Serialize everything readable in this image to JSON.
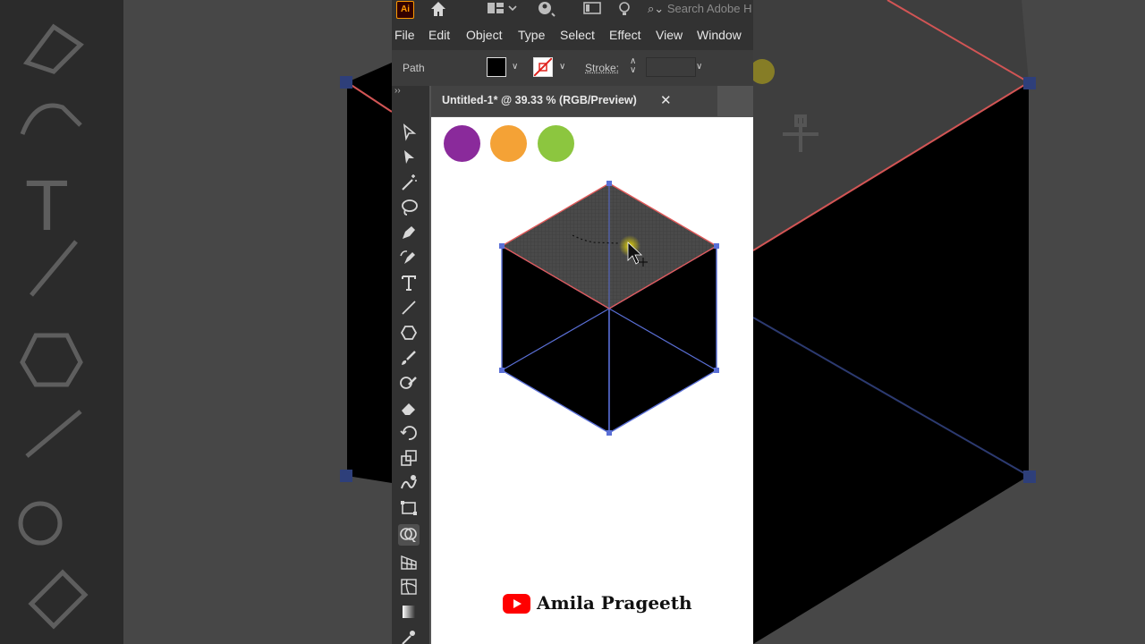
{
  "app": {
    "logo_text": "Ai",
    "search_placeholder": "Search Adobe H"
  },
  "menu": [
    "File",
    "Edit",
    "Object",
    "Type",
    "Select",
    "Effect",
    "View",
    "Window"
  ],
  "control_bar": {
    "selection_label": "Path",
    "stroke_label": "Stroke:"
  },
  "document": {
    "tab_title": "Untitled-1* @ 39.33 % (RGB/Preview)",
    "close_glyph": "✕"
  },
  "swatches": [
    {
      "name": "purple",
      "color": "#8a2a9b"
    },
    {
      "name": "orange",
      "color": "#f4a236"
    },
    {
      "name": "green",
      "color": "#8cc63f"
    }
  ],
  "colors": {
    "cube_top": "#4a4a4a",
    "cube_faces": "#000000",
    "selection_blue": "#5a6fd6",
    "highlight_red": "#e05a5a"
  },
  "tools": [
    "selection-tool-icon",
    "direct-selection-tool-icon",
    "magic-wand-tool-icon",
    "lasso-tool-icon",
    "pen-tool-icon",
    "curvature-tool-icon",
    "type-tool-icon",
    "line-tool-icon",
    "polygon-tool-icon",
    "paintbrush-tool-icon",
    "blob-brush-tool-icon",
    "eraser-tool-icon",
    "rotate-tool-icon",
    "scale-tool-icon",
    "warp-tool-icon",
    "free-transform-tool-icon",
    "shape-builder-tool-icon",
    "perspective-grid-tool-icon",
    "mesh-tool-icon",
    "gradient-tool-icon",
    "eyedropper-tool-icon"
  ],
  "watermark": {
    "author": "Amila Prageeth"
  }
}
